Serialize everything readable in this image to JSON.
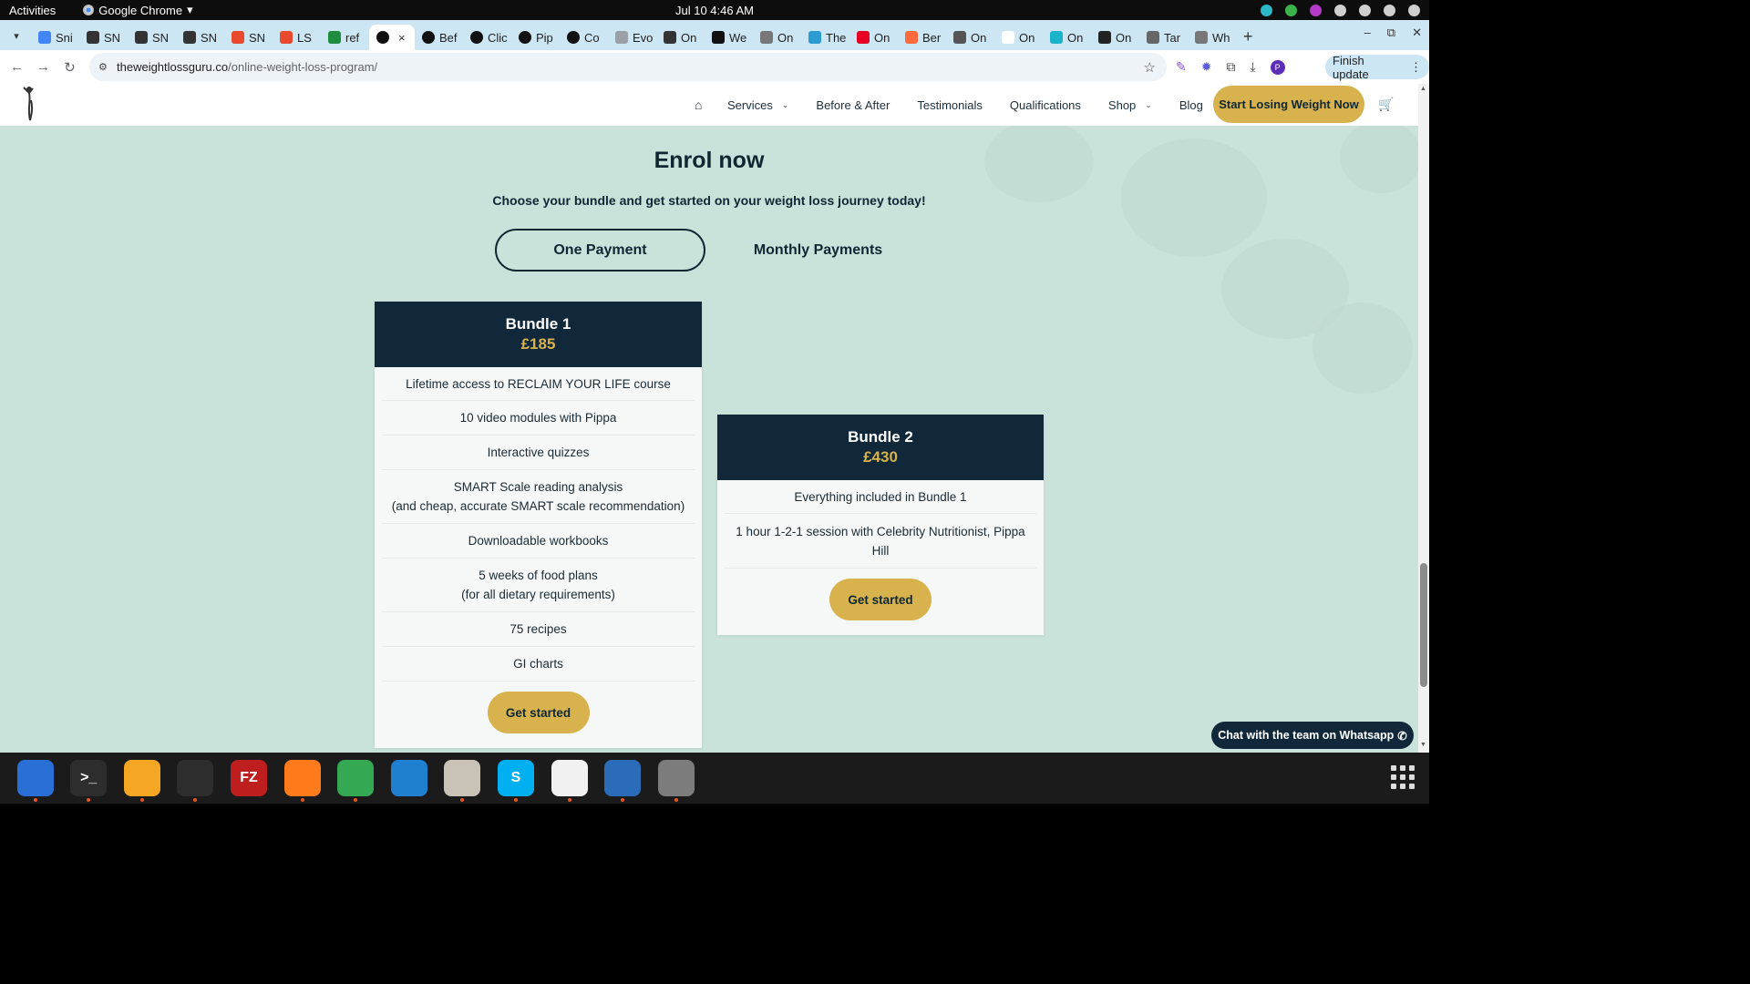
{
  "system_bar": {
    "activities": "Activities",
    "app_name": "Google Chrome",
    "app_menu_arrow": "▾",
    "clock": "Jul 10  4:46 AM"
  },
  "tabs": [
    {
      "label": "Sni",
      "icon": "google-docs-icon",
      "color": "#4285f4"
    },
    {
      "label": "SN",
      "icon": "snp-icon",
      "color": "#333333"
    },
    {
      "label": "SN",
      "icon": "snp-icon",
      "color": "#333333"
    },
    {
      "label": "SN",
      "icon": "snp-icon",
      "color": "#333333"
    },
    {
      "label": "SN",
      "icon": "smiley-icon",
      "color": "#e8492f"
    },
    {
      "label": "LS",
      "icon": "ls-icon",
      "color": "#e8492f"
    },
    {
      "label": "ref",
      "icon": "sheets-plus-icon",
      "color": "#1e8e3e"
    },
    {
      "label": "",
      "icon": "info-icon",
      "color": "#111111",
      "active": true
    },
    {
      "label": "Bef",
      "icon": "info-icon",
      "color": "#111111"
    },
    {
      "label": "Clic",
      "icon": "info-icon",
      "color": "#111111"
    },
    {
      "label": "Pip",
      "icon": "info-icon",
      "color": "#111111"
    },
    {
      "label": "Co",
      "icon": "info-icon",
      "color": "#111111"
    },
    {
      "label": "Evo",
      "icon": "cloud-icon",
      "color": "#9aa0a6"
    },
    {
      "label": "On",
      "icon": "openai-icon",
      "color": "#333333"
    },
    {
      "label": "We",
      "icon": "u-icon",
      "color": "#111111"
    },
    {
      "label": "On",
      "icon": "stack-icon",
      "color": "#777777"
    },
    {
      "label": "The",
      "icon": "grid-icon",
      "color": "#2b9bd2"
    },
    {
      "label": "On",
      "icon": "pinterest-icon",
      "color": "#e60023"
    },
    {
      "label": "Ber",
      "icon": "link-icon",
      "color": "#ff6a3d"
    },
    {
      "label": "On",
      "icon": "run-icon",
      "color": "#555555"
    },
    {
      "label": "On",
      "icon": "face-icon",
      "color": "#ffffff"
    },
    {
      "label": "On",
      "icon": "teal-circle-icon",
      "color": "#1ab3c9"
    },
    {
      "label": "On",
      "icon": "dark-circle-icon",
      "color": "#222222"
    },
    {
      "label": "Tar",
      "icon": "globe-icon",
      "color": "#666666"
    },
    {
      "label": "Wh",
      "icon": "wh-icon",
      "color": "#777777"
    }
  ],
  "tab_close": "×",
  "new_tab": "+",
  "window_controls": {
    "minimize": "–",
    "restore": "⧉",
    "close": "✕"
  },
  "address_bar": {
    "url_host": "theweightlossguru.co",
    "url_path": "/online-weight-loss-program/",
    "finish_update": "Finish update",
    "profile_initial": "P"
  },
  "site": {
    "nav": [
      {
        "label": "Services",
        "dropdown": true
      },
      {
        "label": "Before & After",
        "dropdown": false
      },
      {
        "label": "Testimonials",
        "dropdown": false
      },
      {
        "label": "Qualifications",
        "dropdown": false
      },
      {
        "label": "Shop",
        "dropdown": true
      },
      {
        "label": "Blog",
        "dropdown": false
      }
    ],
    "cta": "Start Losing Weight Now",
    "enrol_title": "Enrol now",
    "enrol_subtitle": "Choose your bundle and get started on your weight loss journey today!",
    "payment_toggle": {
      "one": "One Payment",
      "monthly": "Monthly Payments"
    },
    "bundles": [
      {
        "name": "Bundle 1",
        "price": "£185",
        "features": [
          [
            "Lifetime access to RECLAIM YOUR LIFE course"
          ],
          [
            "10 video modules with Pippa"
          ],
          [
            "Interactive quizzes"
          ],
          [
            "SMART Scale reading analysis",
            "(and cheap, accurate SMART scale recommendation)"
          ],
          [
            "Downloadable workbooks"
          ],
          [
            "5 weeks of food plans",
            "(for all dietary requirements)"
          ],
          [
            "75 recipes"
          ],
          [
            "GI charts"
          ]
        ],
        "button": "Get started"
      },
      {
        "name": "Bundle 2",
        "price": "£430",
        "features": [
          [
            "Everything included in Bundle 1"
          ],
          [
            "1 hour 1-2-1 session with Celebrity Nutritionist, Pippa",
            "Hill"
          ]
        ],
        "button": "Get started"
      }
    ],
    "whatsapp": "Chat with the team on Whatsapp",
    "colors": {
      "navy": "#11283a",
      "gold": "#d7b24d",
      "background": "#c9e2da"
    }
  },
  "dock": [
    {
      "name": "thunderbird",
      "color": "#2a6fd6",
      "running": true
    },
    {
      "name": "terminal",
      "color": "#2d2d2d",
      "running": true,
      "glyph": ">_"
    },
    {
      "name": "calculator",
      "color": "#f5a623",
      "running": true
    },
    {
      "name": "system-monitor",
      "color": "#2d2d2d",
      "running": true
    },
    {
      "name": "filezilla",
      "color": "#bf1e1e",
      "running": false,
      "glyph": "FZ"
    },
    {
      "name": "firefox",
      "color": "#ff7a1a",
      "running": true
    },
    {
      "name": "chrome",
      "color": "#34a853",
      "running": true
    },
    {
      "name": "vscode",
      "color": "#1f7fd1",
      "running": false
    },
    {
      "name": "files",
      "color": "#c9c3b7",
      "running": true
    },
    {
      "name": "skype",
      "color": "#00aff0",
      "running": true,
      "glyph": "S"
    },
    {
      "name": "text-editor",
      "color": "#f1f1f1",
      "running": true
    },
    {
      "name": "document-viewer",
      "color": "#2b6cb8",
      "running": true
    },
    {
      "name": "disk-utility",
      "color": "#7c7c7c",
      "running": true
    }
  ]
}
